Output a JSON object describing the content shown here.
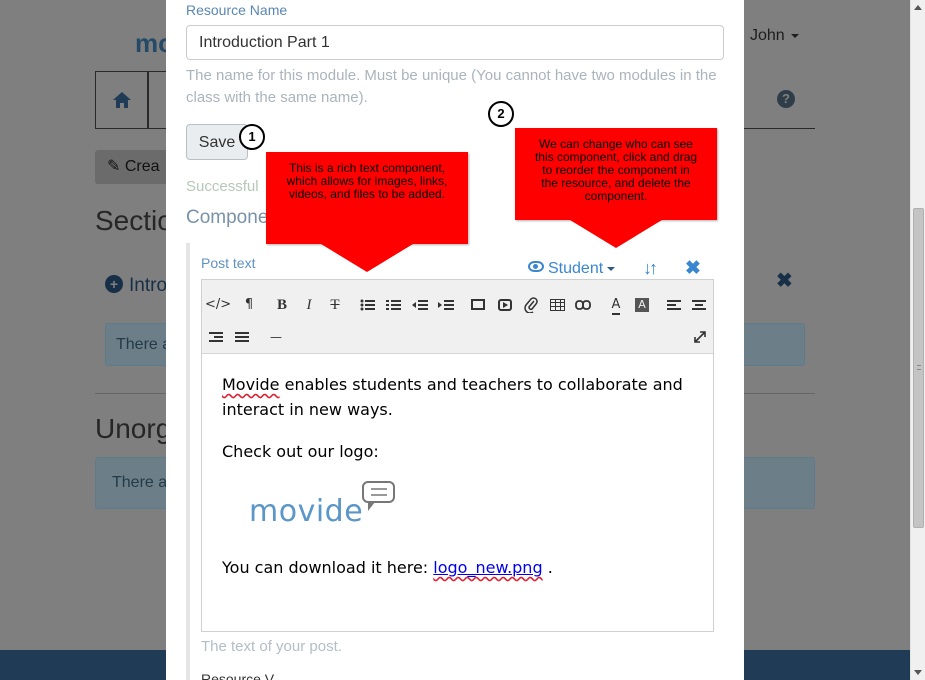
{
  "background": {
    "logo_fragment": "mo",
    "user_menu": "John",
    "create_button": "Crea",
    "section_heading": "Sectio",
    "intro_item": "Intro",
    "alert1": "There a",
    "unorganized_heading": "Unorg",
    "alert2": "There a"
  },
  "modal": {
    "resource_name_label": "Resource Name",
    "resource_name_value": "Introduction Part 1",
    "resource_name_help": "The name for this module. Must be unique (You cannot have two modules in the class with the same name).",
    "save_label": "Save",
    "success_text": "Successful",
    "components_heading": "Compone",
    "post_text_label": "Post text",
    "visibility_label": "Student",
    "editor_content": {
      "paragraph1_spell": "Movide",
      "paragraph1_rest": " enables students and teachers to collaborate and interact in new ways.",
      "paragraph2": "Check out our logo:",
      "logo_text": "movide",
      "download_text": "You can download it here: ",
      "download_link": "logo_new.png",
      "download_suffix": " ."
    },
    "post_help": "The text of your post.",
    "cut_off_label": "Resource V..."
  },
  "toolbar": {
    "code": "</>",
    "paragraph": "¶",
    "bold": "B",
    "italic": "I",
    "strike": "T",
    "hr": "—",
    "font_color": "A",
    "back_color": "A"
  },
  "annotations": {
    "callout_rich_text": "This is a rich text component, which allows for images, links, videos, and files to be added.",
    "callout_visibility": "We can change who can see this component, click and drag to reorder the component in the resource, and delete the component.",
    "step1": "1",
    "step2": "2"
  },
  "colors": {
    "accent": "#3a86d0",
    "callout": "#ff0000",
    "overlay": "#7f7f7f"
  }
}
